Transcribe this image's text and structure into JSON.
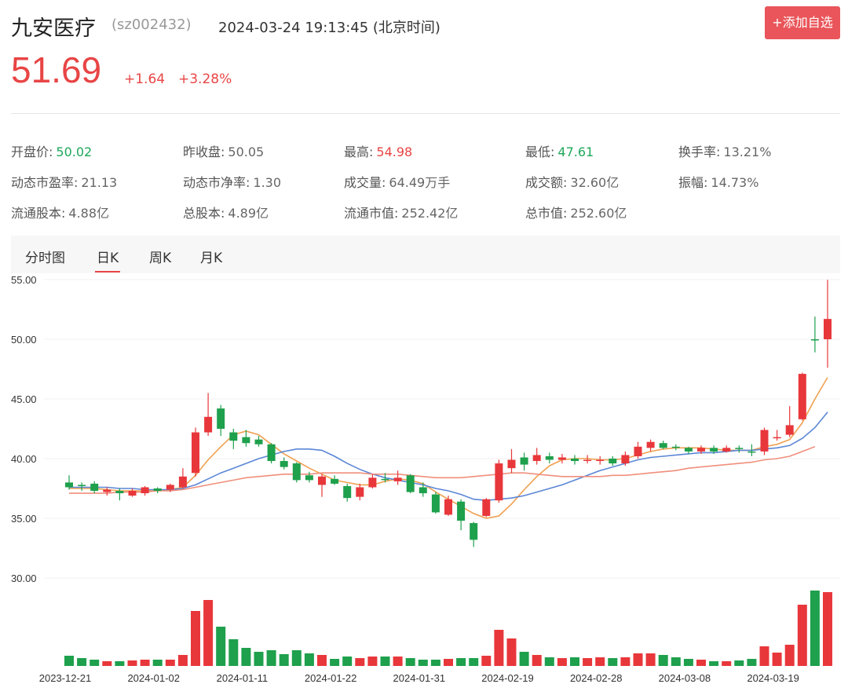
{
  "header": {
    "stock_name": "九安医疗",
    "stock_code": "(sz002432)",
    "timestamp": "2024-03-24 19:13:45 (北京时间)",
    "add_button": "+添加自选"
  },
  "quote": {
    "price": "51.69",
    "change": "+1.64",
    "change_pct": "+3.28%"
  },
  "stats": [
    {
      "label": "开盘价:",
      "value": "50.02",
      "tone": "down"
    },
    {
      "label": "昨收盘:",
      "value": "50.05",
      "tone": "flat"
    },
    {
      "label": "最高:",
      "value": "54.98",
      "tone": "up"
    },
    {
      "label": "最低:",
      "value": "47.61",
      "tone": "down"
    },
    {
      "label": "换手率:",
      "value": "13.21%",
      "tone": "flat"
    },
    {
      "label": "动态市盈率:",
      "value": "21.13",
      "tone": "flat"
    },
    {
      "label": "动态市净率:",
      "value": "1.30",
      "tone": "flat"
    },
    {
      "label": "成交量:",
      "value": "64.49万手",
      "tone": "flat"
    },
    {
      "label": "成交额:",
      "value": "32.60亿",
      "tone": "flat"
    },
    {
      "label": "振幅:",
      "value": "14.73%",
      "tone": "flat"
    },
    {
      "label": "流通股本:",
      "value": "4.88亿",
      "tone": "flat"
    },
    {
      "label": "总股本:",
      "value": "4.89亿",
      "tone": "flat"
    },
    {
      "label": "流通市值:",
      "value": "252.42亿",
      "tone": "flat"
    },
    {
      "label": "总市值:",
      "value": "252.60亿",
      "tone": "flat"
    }
  ],
  "tabs": [
    {
      "label": "分时图",
      "active": false
    },
    {
      "label": "日K",
      "active": true
    },
    {
      "label": "周K",
      "active": false
    },
    {
      "label": "月K",
      "active": false
    }
  ],
  "colors": {
    "up": "#e8373b",
    "down": "#1ea04c",
    "ma_short": "#f0a050",
    "ma_mid": "#5b86d6",
    "ma_long": "#f08f7c"
  },
  "chart_data": {
    "type": "candlestick",
    "y_ticks": [
      "55.00",
      "50.00",
      "45.00",
      "40.00",
      "35.00",
      "30.00"
    ],
    "ylim": [
      30,
      55
    ],
    "x_ticks": [
      {
        "index": 0,
        "label": "2023-12-21"
      },
      {
        "index": 7,
        "label": "2024-01-02"
      },
      {
        "index": 14,
        "label": "2024-01-11"
      },
      {
        "index": 21,
        "label": "2024-01-22"
      },
      {
        "index": 28,
        "label": "2024-01-31"
      },
      {
        "index": 35,
        "label": "2024-02-19"
      },
      {
        "index": 42,
        "label": "2024-02-28"
      },
      {
        "index": 49,
        "label": "2024-03-08"
      },
      {
        "index": 56,
        "label": "2024-03-19"
      }
    ],
    "candles": [
      {
        "o": 38.0,
        "c": 37.6,
        "h": 38.6,
        "l": 37.4,
        "v": 13
      },
      {
        "o": 37.8,
        "c": 37.7,
        "h": 38.0,
        "l": 37.3,
        "v": 10
      },
      {
        "o": 37.9,
        "c": 37.3,
        "h": 38.1,
        "l": 37.1,
        "v": 8
      },
      {
        "o": 37.2,
        "c": 37.4,
        "h": 37.6,
        "l": 36.9,
        "v": 6
      },
      {
        "o": 37.3,
        "c": 37.1,
        "h": 37.5,
        "l": 36.5,
        "v": 6
      },
      {
        "o": 36.9,
        "c": 37.3,
        "h": 37.5,
        "l": 36.8,
        "v": 7
      },
      {
        "o": 37.1,
        "c": 37.6,
        "h": 37.7,
        "l": 36.9,
        "v": 8
      },
      {
        "o": 37.5,
        "c": 37.3,
        "h": 37.6,
        "l": 37.1,
        "v": 8
      },
      {
        "o": 37.4,
        "c": 37.8,
        "h": 37.9,
        "l": 37.2,
        "v": 8
      },
      {
        "o": 37.6,
        "c": 38.5,
        "h": 39.2,
        "l": 37.5,
        "v": 14
      },
      {
        "o": 38.8,
        "c": 42.2,
        "h": 42.6,
        "l": 38.5,
        "v": 70
      },
      {
        "o": 42.2,
        "c": 43.5,
        "h": 45.5,
        "l": 41.9,
        "v": 84
      },
      {
        "o": 44.2,
        "c": 42.5,
        "h": 44.5,
        "l": 41.9,
        "v": 50
      },
      {
        "o": 42.2,
        "c": 41.5,
        "h": 42.5,
        "l": 40.8,
        "v": 34
      },
      {
        "o": 41.8,
        "c": 41.3,
        "h": 42.4,
        "l": 41.0,
        "v": 23
      },
      {
        "o": 41.6,
        "c": 41.2,
        "h": 41.9,
        "l": 41.0,
        "v": 18
      },
      {
        "o": 41.2,
        "c": 39.8,
        "h": 41.3,
        "l": 39.6,
        "v": 20
      },
      {
        "o": 39.8,
        "c": 39.3,
        "h": 40.1,
        "l": 39.1,
        "v": 15
      },
      {
        "o": 39.6,
        "c": 38.2,
        "h": 39.7,
        "l": 38.0,
        "v": 20
      },
      {
        "o": 38.6,
        "c": 38.2,
        "h": 38.9,
        "l": 38.0,
        "v": 16
      },
      {
        "o": 37.8,
        "c": 38.5,
        "h": 38.7,
        "l": 36.8,
        "v": 14
      },
      {
        "o": 38.3,
        "c": 37.9,
        "h": 38.6,
        "l": 37.8,
        "v": 9
      },
      {
        "o": 37.7,
        "c": 36.7,
        "h": 37.9,
        "l": 36.4,
        "v": 12
      },
      {
        "o": 36.8,
        "c": 37.6,
        "h": 37.9,
        "l": 36.5,
        "v": 10
      },
      {
        "o": 37.6,
        "c": 38.4,
        "h": 38.7,
        "l": 37.5,
        "v": 12
      },
      {
        "o": 38.3,
        "c": 38.2,
        "h": 38.8,
        "l": 38.0,
        "v": 12
      },
      {
        "o": 38.1,
        "c": 38.4,
        "h": 39.0,
        "l": 37.8,
        "v": 12
      },
      {
        "o": 38.6,
        "c": 37.2,
        "h": 38.7,
        "l": 37.1,
        "v": 10
      },
      {
        "o": 37.6,
        "c": 37.1,
        "h": 38.0,
        "l": 36.8,
        "v": 8
      },
      {
        "o": 37.0,
        "c": 35.5,
        "h": 37.2,
        "l": 35.4,
        "v": 8
      },
      {
        "o": 35.3,
        "c": 36.6,
        "h": 36.9,
        "l": 35.2,
        "v": 9
      },
      {
        "o": 36.4,
        "c": 34.8,
        "h": 36.6,
        "l": 34.0,
        "v": 10
      },
      {
        "o": 34.6,
        "c": 33.2,
        "h": 34.7,
        "l": 32.6,
        "v": 10
      },
      {
        "o": 35.2,
        "c": 36.6,
        "h": 36.7,
        "l": 35.1,
        "v": 13
      },
      {
        "o": 36.5,
        "c": 39.6,
        "h": 39.9,
        "l": 36.3,
        "v": 46
      },
      {
        "o": 39.2,
        "c": 39.9,
        "h": 40.8,
        "l": 38.8,
        "v": 35
      },
      {
        "o": 40.1,
        "c": 39.5,
        "h": 40.5,
        "l": 39.0,
        "v": 18
      },
      {
        "o": 39.8,
        "c": 40.3,
        "h": 40.9,
        "l": 39.5,
        "v": 14
      },
      {
        "o": 40.2,
        "c": 39.9,
        "h": 40.5,
        "l": 39.6,
        "v": 11
      },
      {
        "o": 39.9,
        "c": 40.1,
        "h": 40.4,
        "l": 39.6,
        "v": 10
      },
      {
        "o": 40.0,
        "c": 39.8,
        "h": 40.3,
        "l": 39.5,
        "v": 11
      },
      {
        "o": 39.9,
        "c": 39.9,
        "h": 40.3,
        "l": 39.6,
        "v": 10
      },
      {
        "o": 39.8,
        "c": 39.9,
        "h": 40.2,
        "l": 39.5,
        "v": 11
      },
      {
        "o": 40.0,
        "c": 39.6,
        "h": 40.2,
        "l": 39.4,
        "v": 10
      },
      {
        "o": 39.6,
        "c": 40.3,
        "h": 40.6,
        "l": 39.4,
        "v": 11
      },
      {
        "o": 40.2,
        "c": 41.0,
        "h": 41.4,
        "l": 40.0,
        "v": 16
      },
      {
        "o": 40.9,
        "c": 41.4,
        "h": 41.6,
        "l": 40.6,
        "v": 16
      },
      {
        "o": 41.3,
        "c": 40.9,
        "h": 41.5,
        "l": 40.8,
        "v": 14
      },
      {
        "o": 41.0,
        "c": 40.9,
        "h": 41.2,
        "l": 40.7,
        "v": 11
      },
      {
        "o": 40.9,
        "c": 40.6,
        "h": 41.0,
        "l": 40.4,
        "v": 9
      },
      {
        "o": 40.6,
        "c": 40.9,
        "h": 41.1,
        "l": 40.4,
        "v": 8
      },
      {
        "o": 40.9,
        "c": 40.6,
        "h": 41.1,
        "l": 40.4,
        "v": 6
      },
      {
        "o": 40.6,
        "c": 40.9,
        "h": 41.1,
        "l": 40.5,
        "v": 6
      },
      {
        "o": 40.9,
        "c": 40.8,
        "h": 41.1,
        "l": 40.5,
        "v": 7
      },
      {
        "o": 40.6,
        "c": 40.5,
        "h": 41.2,
        "l": 40.2,
        "v": 9
      },
      {
        "o": 40.6,
        "c": 42.4,
        "h": 42.6,
        "l": 40.3,
        "v": 25
      },
      {
        "o": 41.8,
        "c": 41.8,
        "h": 42.4,
        "l": 41.5,
        "v": 17
      },
      {
        "o": 42.0,
        "c": 42.8,
        "h": 44.4,
        "l": 41.8,
        "v": 27
      },
      {
        "o": 43.3,
        "c": 47.1,
        "h": 47.2,
        "l": 43.2,
        "v": 78
      },
      {
        "o": 50.0,
        "c": 49.9,
        "h": 51.9,
        "l": 48.9,
        "v": 96
      },
      {
        "o": 50.0,
        "c": 51.7,
        "h": 54.98,
        "l": 47.61,
        "v": 94
      }
    ],
    "moving_averages": [
      {
        "name": "ma5",
        "color": "#f0a050",
        "values": [
          37.5,
          37.5,
          37.5,
          37.4,
          37.3,
          37.3,
          37.3,
          37.3,
          37.4,
          37.6,
          38.6,
          39.9,
          41.0,
          42.0,
          42.3,
          42.0,
          41.2,
          40.4,
          39.8,
          39.2,
          38.7,
          38.2,
          38.0,
          37.8,
          37.8,
          38.1,
          38.3,
          38.2,
          37.9,
          37.2,
          36.6,
          36.0,
          35.4,
          35.0,
          35.2,
          36.2,
          37.4,
          38.5,
          39.4,
          39.9,
          40.0,
          40.0,
          39.9,
          39.9,
          40.0,
          40.3,
          40.6,
          40.8,
          40.9,
          40.9,
          40.9,
          40.8,
          40.7,
          40.7,
          40.7,
          41.0,
          41.2,
          41.6,
          43.0,
          45.0,
          46.8
        ]
      },
      {
        "name": "ma10",
        "color": "#5b86d6",
        "values": [
          37.6,
          37.6,
          37.6,
          37.6,
          37.5,
          37.5,
          37.4,
          37.4,
          37.4,
          37.5,
          37.8,
          38.3,
          38.8,
          39.2,
          39.6,
          40.0,
          40.3,
          40.6,
          40.8,
          40.8,
          40.7,
          40.2,
          39.6,
          39.1,
          38.7,
          38.4,
          38.2,
          38.0,
          37.8,
          37.5,
          37.3,
          37.0,
          36.6,
          36.5,
          36.6,
          36.7,
          36.9,
          37.2,
          37.5,
          37.8,
          38.2,
          38.6,
          39.0,
          39.3,
          39.6,
          39.9,
          40.1,
          40.2,
          40.3,
          40.4,
          40.5,
          40.5,
          40.6,
          40.7,
          40.7,
          40.8,
          40.9,
          41.1,
          41.7,
          42.6,
          43.9
        ]
      },
      {
        "name": "ma20",
        "color": "#f08f7c",
        "values": [
          37.1,
          37.1,
          37.1,
          37.1,
          37.2,
          37.2,
          37.2,
          37.3,
          37.3,
          37.4,
          37.6,
          37.8,
          38.0,
          38.2,
          38.4,
          38.5,
          38.6,
          38.7,
          38.7,
          38.7,
          38.8,
          38.8,
          38.8,
          38.8,
          38.7,
          38.7,
          38.7,
          38.6,
          38.5,
          38.4,
          38.4,
          38.4,
          38.5,
          38.6,
          38.7,
          38.8,
          38.8,
          38.7,
          38.6,
          38.5,
          38.5,
          38.5,
          38.5,
          38.6,
          38.6,
          38.7,
          38.8,
          38.9,
          39.0,
          39.2,
          39.3,
          39.4,
          39.5,
          39.6,
          39.7,
          39.9,
          40.0,
          40.2,
          40.6,
          41.0
        ]
      }
    ]
  }
}
